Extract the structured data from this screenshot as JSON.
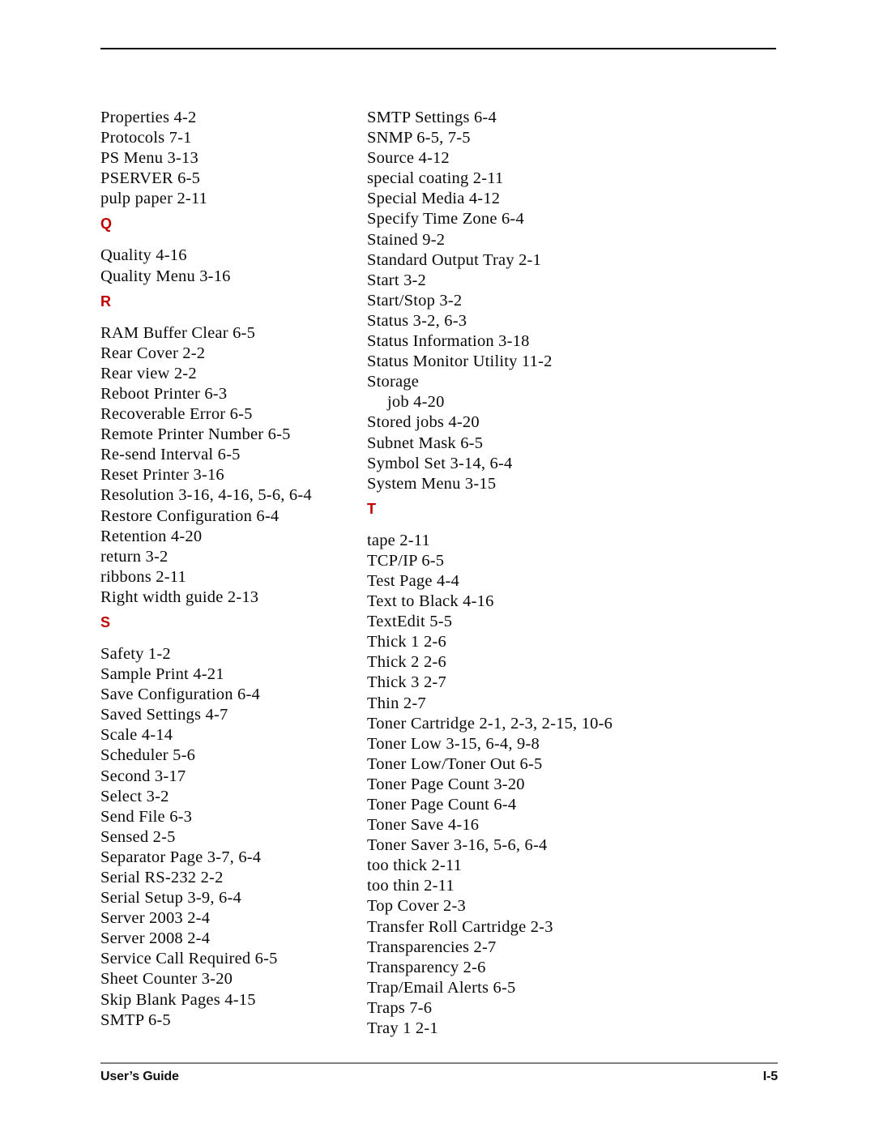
{
  "document": {
    "type": "index-page",
    "accent_color": "#c00000",
    "rule_color_top": "#000000",
    "rule_color_footer": "#808080"
  },
  "footer": {
    "left_label": "User’s Guide",
    "page_number": "I-5"
  },
  "columns": [
    {
      "name": "left-column",
      "blocks": [
        {
          "type": "entries",
          "items": [
            {
              "text": "Properties 4-2",
              "indent": false
            },
            {
              "text": "Protocols 7-1",
              "indent": false
            },
            {
              "text": "PS Menu 3-13",
              "indent": false
            },
            {
              "text": "PSERVER 6-5",
              "indent": false
            },
            {
              "text": "pulp paper 2-11",
              "indent": false
            }
          ]
        },
        {
          "type": "heading",
          "letter": "Q"
        },
        {
          "type": "entries",
          "items": [
            {
              "text": "Quality 4-16",
              "indent": false
            },
            {
              "text": "Quality Menu 3-16",
              "indent": false
            }
          ]
        },
        {
          "type": "heading",
          "letter": "R"
        },
        {
          "type": "entries",
          "items": [
            {
              "text": "RAM Buffer Clear 6-5",
              "indent": false
            },
            {
              "text": "Rear Cover 2-2",
              "indent": false
            },
            {
              "text": "Rear view 2-2",
              "indent": false
            },
            {
              "text": "Reboot Printer 6-3",
              "indent": false
            },
            {
              "text": "Recoverable Error 6-5",
              "indent": false
            },
            {
              "text": "Remote Printer Number 6-5",
              "indent": false
            },
            {
              "text": "Re-send Interval 6-5",
              "indent": false
            },
            {
              "text": "Reset Printer 3-16",
              "indent": false
            },
            {
              "text": "Resolution 3-16, 4-16, 5-6, 6-4",
              "indent": false
            },
            {
              "text": "Restore Configuration 6-4",
              "indent": false
            },
            {
              "text": "Retention 4-20",
              "indent": false
            },
            {
              "text": "return 3-2",
              "indent": false
            },
            {
              "text": "ribbons 2-11",
              "indent": false
            },
            {
              "text": "Right width guide 2-13",
              "indent": false
            }
          ]
        },
        {
          "type": "heading",
          "letter": "S"
        },
        {
          "type": "entries",
          "items": [
            {
              "text": "Safety 1-2",
              "indent": false
            },
            {
              "text": "Sample Print 4-21",
              "indent": false
            },
            {
              "text": "Save Configuration 6-4",
              "indent": false
            },
            {
              "text": "Saved Settings 4-7",
              "indent": false
            },
            {
              "text": "Scale 4-14",
              "indent": false
            },
            {
              "text": "Scheduler 5-6",
              "indent": false
            },
            {
              "text": "Second 3-17",
              "indent": false
            },
            {
              "text": "Select 3-2",
              "indent": false
            },
            {
              "text": "Send File 6-3",
              "indent": false
            },
            {
              "text": "Sensed 2-5",
              "indent": false
            },
            {
              "text": "Separator Page 3-7, 6-4",
              "indent": false
            },
            {
              "text": "Serial RS-232 2-2",
              "indent": false
            },
            {
              "text": "Serial Setup 3-9, 6-4",
              "indent": false
            },
            {
              "text": "Server 2003 2-4",
              "indent": false
            },
            {
              "text": "Server 2008 2-4",
              "indent": false
            },
            {
              "text": "Service Call Required 6-5",
              "indent": false
            },
            {
              "text": "Sheet Counter 3-20",
              "indent": false
            },
            {
              "text": "Skip Blank Pages 4-15",
              "indent": false
            },
            {
              "text": "SMTP 6-5",
              "indent": false
            }
          ]
        }
      ]
    },
    {
      "name": "right-column",
      "blocks": [
        {
          "type": "entries",
          "items": [
            {
              "text": "SMTP Settings 6-4",
              "indent": false
            },
            {
              "text": "SNMP 6-5, 7-5",
              "indent": false
            },
            {
              "text": "Source 4-12",
              "indent": false
            },
            {
              "text": "special coating 2-11",
              "indent": false
            },
            {
              "text": "Special Media 4-12",
              "indent": false
            },
            {
              "text": "Specify Time Zone 6-4",
              "indent": false
            },
            {
              "text": "Stained 9-2",
              "indent": false
            },
            {
              "text": "Standard Output Tray 2-1",
              "indent": false
            },
            {
              "text": "Start 3-2",
              "indent": false
            },
            {
              "text": "Start/Stop 3-2",
              "indent": false
            },
            {
              "text": "Status 3-2, 6-3",
              "indent": false
            },
            {
              "text": "Status Information 3-18",
              "indent": false
            },
            {
              "text": "Status Monitor Utility 11-2",
              "indent": false
            },
            {
              "text": "Storage",
              "indent": false
            },
            {
              "text": "job 4-20",
              "indent": true
            },
            {
              "text": "Stored jobs 4-20",
              "indent": false
            },
            {
              "text": "Subnet Mask 6-5",
              "indent": false
            },
            {
              "text": "Symbol Set 3-14, 6-4",
              "indent": false
            },
            {
              "text": "System Menu 3-15",
              "indent": false
            }
          ]
        },
        {
          "type": "heading",
          "letter": "T"
        },
        {
          "type": "entries",
          "items": [
            {
              "text": "tape 2-11",
              "indent": false
            },
            {
              "text": "TCP/IP 6-5",
              "indent": false
            },
            {
              "text": "Test Page 4-4",
              "indent": false
            },
            {
              "text": "Text to Black 4-16",
              "indent": false
            },
            {
              "text": "TextEdit 5-5",
              "indent": false
            },
            {
              "text": "Thick 1 2-6",
              "indent": false
            },
            {
              "text": "Thick 2 2-6",
              "indent": false
            },
            {
              "text": "Thick 3 2-7",
              "indent": false
            },
            {
              "text": "Thin 2-7",
              "indent": false
            },
            {
              "text": "Toner Cartridge 2-1, 2-3, 2-15, 10-6",
              "indent": false
            },
            {
              "text": "Toner Low 3-15, 6-4, 9-8",
              "indent": false
            },
            {
              "text": "Toner Low/Toner Out 6-5",
              "indent": false
            },
            {
              "text": "Toner Page Count 3-20",
              "indent": false
            },
            {
              "text": "Toner Page Count 6-4",
              "indent": false
            },
            {
              "text": "Toner Save 4-16",
              "indent": false
            },
            {
              "text": "Toner Saver 3-16, 5-6, 6-4",
              "indent": false
            },
            {
              "text": "too thick 2-11",
              "indent": false
            },
            {
              "text": "too thin 2-11",
              "indent": false
            },
            {
              "text": "Top Cover 2-3",
              "indent": false
            },
            {
              "text": "Transfer Roll Cartridge 2-3",
              "indent": false
            },
            {
              "text": "Transparencies 2-7",
              "indent": false
            },
            {
              "text": "Transparency 2-6",
              "indent": false
            },
            {
              "text": "Trap/Email Alerts 6-5",
              "indent": false
            },
            {
              "text": "Traps 7-6",
              "indent": false
            },
            {
              "text": "Tray 1 2-1",
              "indent": false
            }
          ]
        }
      ]
    }
  ]
}
